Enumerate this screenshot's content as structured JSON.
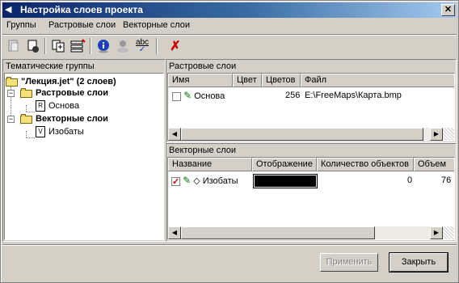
{
  "window": {
    "title": "Настройка слоев проекта",
    "close_symbol": "✕"
  },
  "menu": {
    "items": [
      "Группы",
      "Растровые слои",
      "Векторные слои"
    ]
  },
  "toolbar": {
    "icons": [
      "add-group-icon",
      "remove-group-icon",
      "copy-layer-icon",
      "layer-properties-icon",
      "info-icon",
      "user-icon",
      "spellcheck-icon",
      "delete-icon"
    ],
    "spellcheck_text": "abc"
  },
  "left_panel": {
    "title": "Тематические группы",
    "tree": {
      "root": "\"Лекция.jet\" (2 слоев)",
      "groups": [
        {
          "label": "Растровые слои",
          "children": [
            "Основа"
          ]
        },
        {
          "label": "Векторные слои",
          "children": [
            "Изобаты"
          ]
        }
      ]
    }
  },
  "raster_panel": {
    "title": "Растровые слои",
    "columns": [
      "Имя",
      "Цвет",
      "Цветов",
      "Файл"
    ],
    "rows": [
      {
        "name": "Основа",
        "checked": false,
        "colors": "256",
        "file": "E:\\FreeMaps\\Карта.bmp"
      }
    ]
  },
  "vector_panel": {
    "title": "Векторные слои",
    "columns": [
      "Название",
      "Отображение",
      "Количество объектов",
      "Объем"
    ],
    "rows": [
      {
        "name": "Изобаты",
        "checked": true,
        "display_color": "#000000",
        "count": "0",
        "volume": "76"
      }
    ]
  },
  "buttons": {
    "apply": "Применить",
    "close": "Закрыть"
  },
  "colors": {
    "title_start": "#0a246a",
    "title_end": "#a6caf0",
    "face": "#d4d0c8",
    "delete_red": "#cc0000"
  }
}
